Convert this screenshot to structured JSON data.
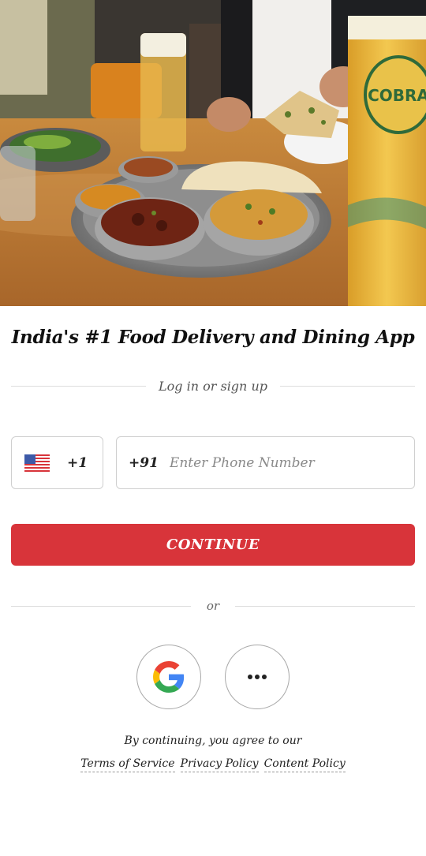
{
  "hero": {
    "glass_brand": "COBRA",
    "accent_colors": {
      "table": "#b8782f",
      "beer": "#e8b43a"
    }
  },
  "headline": "India's #1 Food Delivery and Dining App",
  "login_divider_label": "Log in or sign up",
  "country_selector": {
    "flag": "us-flag-icon",
    "code": "+1"
  },
  "phone_field": {
    "prefix": "+91",
    "value": "",
    "placeholder": "Enter Phone Number"
  },
  "continue_label": "CONTINUE",
  "or_label": "or",
  "social": {
    "google_icon": "google-icon",
    "more_icon": "more-options-icon"
  },
  "terms": {
    "agree_text": "By continuing, you agree to our",
    "links": [
      "Terms of Service",
      "Privacy Policy",
      "Content Policy"
    ]
  },
  "colors": {
    "primary": "#d8343a",
    "border": "#cfcfcf",
    "divider": "#dcdcdc"
  }
}
